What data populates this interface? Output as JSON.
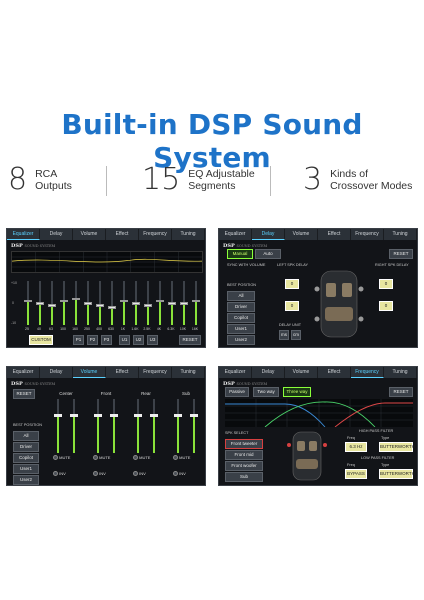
{
  "headline": "Built-in DSP Sound System",
  "stats": [
    {
      "num": "8",
      "line1": "RCA",
      "line2": "Outputs"
    },
    {
      "num": "15",
      "line1": "EQ Adjustable",
      "line2": "Segments"
    },
    {
      "num": "3",
      "line1": "Kinds of",
      "line2": "Crossover Modes"
    }
  ],
  "tabs": [
    "Equalizer",
    "Delay",
    "Volume",
    "Effect",
    "Frequency",
    "Tuning"
  ],
  "brand": "DSP",
  "brand_sub": "SOUND SYSTEM",
  "eq": {
    "scale_top": "+10",
    "scale_mid": "0",
    "scale_bot": "-10",
    "freqs": [
      "25",
      "40",
      "63",
      "100",
      "160",
      "250",
      "400",
      "630",
      "1K",
      "1.6K",
      "2.5K",
      "4K",
      "6.3K",
      "10K",
      "16K"
    ],
    "levels": [
      0.55,
      0.5,
      0.45,
      0.55,
      0.6,
      0.5,
      0.45,
      0.4,
      0.55,
      0.5,
      0.45,
      0.55,
      0.5,
      0.5,
      0.55
    ],
    "preset_label": "CUSTOM",
    "presets": [
      "P1",
      "P2",
      "P3",
      "U1",
      "U2",
      "U3"
    ],
    "reset_label": "RESET"
  },
  "delay": {
    "modes": [
      "Manual",
      "Auto"
    ],
    "reset_label": "RESET",
    "sync_label": "SYNC WITH VOLUME",
    "left_label": "LEFT SPK DELAY",
    "right_label": "RIGHT SPK DELAY",
    "best_position": "BEST POSITION",
    "positions": [
      "All",
      "Driver",
      "Copilot",
      "User1",
      "User2"
    ],
    "values": [
      "0",
      "0",
      "0",
      "0"
    ],
    "unit_label": "DELAY UNIT",
    "units": [
      "ms",
      "cm"
    ]
  },
  "volume": {
    "reset_label": "RESET",
    "best_position": "BEST POSITION",
    "positions": [
      "All",
      "Driver",
      "Copilot",
      "User1",
      "User2"
    ],
    "channels": [
      {
        "name": "Center",
        "levels": [
          0.7,
          0.7
        ]
      },
      {
        "name": "Front",
        "levels": [
          0.7,
          0.7
        ]
      },
      {
        "name": "Rear",
        "levels": [
          0.7,
          0.7
        ]
      },
      {
        "name": "Sub",
        "levels": [
          0.7,
          0.7
        ]
      }
    ],
    "mute_label": "MUTE",
    "inv_label": "INV",
    "scale": [
      "0",
      "-15"
    ]
  },
  "freq": {
    "modes": [
      "Passive",
      "Two way",
      "Three way"
    ],
    "reset_label": "RESET",
    "spk_select": "SPK SELECT",
    "speakers": [
      "Front tweeter",
      "Front mid",
      "Front woofer",
      "Sub"
    ],
    "hpf_label": "HIGH PASS FILTER",
    "lpf_label": "LOW PASS FILTER",
    "freq_label": "Freq",
    "type_label": "Type",
    "hpf_freq": "6.3 Hz",
    "hpf_type": "BUTTERWORTH",
    "lpf_freq": "BYPASS",
    "lpf_type": "BUTTERWORTH"
  },
  "colors": {
    "accent": "#1e73c8",
    "green": "#8ae23a",
    "panel": "#121418"
  }
}
